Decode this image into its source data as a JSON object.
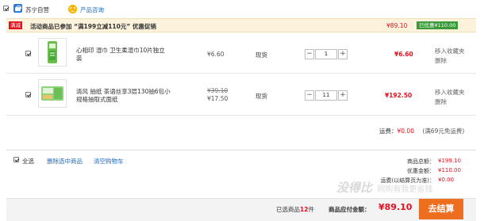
{
  "shop": {
    "name": "苏宁自营",
    "consult_label": "产品咨询"
  },
  "promotion": {
    "tag": "满减",
    "text": "活动商品已参加 “满199立减110元” 优惠促销",
    "total": "¥89.10",
    "saved": "已优惠¥110.00"
  },
  "items": [
    {
      "name_line1": "心相印 湿巾 卫生柔湿巾10片独立",
      "name_line2": "装",
      "price": "¥6.60",
      "stock": "现货",
      "quantity": "1",
      "subtotal": "¥6.60",
      "action_line1": "移入收藏夹",
      "action_line2": "删除"
    },
    {
      "name_line1": "清风 抽纸 茶语丝享3层130抽6包小",
      "name_line2": "规格抽取式面纸",
      "price_original": "¥39.10",
      "price": "¥17.50",
      "stock": "现货",
      "quantity": "11",
      "subtotal": "¥192.50",
      "action_line1": "移入收藏夹",
      "action_line2": "删除"
    }
  ],
  "shipping": {
    "label": "运费：",
    "value": "¥0.00",
    "note": "(满69元免运费)"
  },
  "footer": {
    "select_all": "全选",
    "delete_selected": "删除选中商品",
    "clear_cart": "清空购物车",
    "goods_total_label": "商品总额：",
    "goods_total_value": "¥199.10",
    "discount_label": "优惠金额：",
    "discount_value": "¥110.00",
    "freight_label": "运费(以结算页为准)：",
    "freight_value": "¥0.00",
    "selected_prefix": "已选商品",
    "selected_count": "12",
    "selected_suffix": "件",
    "payable_label": "商品应付金额：",
    "payable_value": "¥89.10",
    "checkout_label": "去结算"
  },
  "watermark": {
    "text1": "没得比",
    "text2": "网购有我更省钱"
  },
  "colors": {
    "price_red": "#e3101e",
    "checkout_orange": "#ee6e20",
    "promo_bg": "#fdf3dc",
    "saved_green": "#3a9a3a",
    "link_blue": "#1a6bc6"
  }
}
